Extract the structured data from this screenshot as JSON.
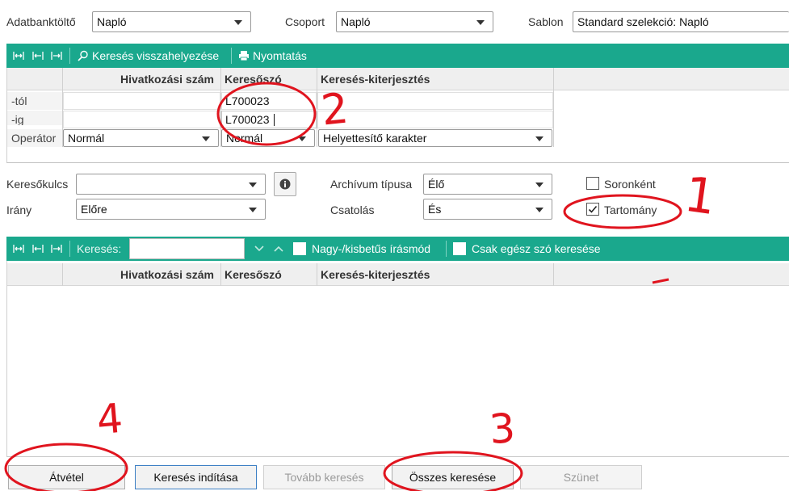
{
  "top_row": {
    "databank_label": "Adatbanktöltő",
    "databank_value": "Napló",
    "group_label": "Csoport",
    "group_value": "Napló",
    "template_label": "Sablon",
    "template_value": "Standard szelekció: Napló"
  },
  "toolbar1": {
    "reset_search": "Keresés visszahelyezése",
    "print": "Nyomtatás"
  },
  "criteria_grid": {
    "columns": [
      "Hivatkozási szám",
      "Keresőszó",
      "Keresés-kiterjesztés"
    ],
    "rows": {
      "from_label": "-tól",
      "to_label": "-ig",
      "operator_label": "Operátor"
    },
    "from_keyword": "L700023",
    "to_keyword": "L700023",
    "operator_ref": "Normál",
    "operator_keyword": "Normál",
    "operator_extension": "Helyettesítő karakter"
  },
  "options": {
    "search_key_label": "Keresőkulcs",
    "search_key_value": "",
    "direction_label": "Irány",
    "direction_value": "Előre",
    "archive_type_label": "Archívum típusa",
    "archive_type_value": "Élő",
    "link_label": "Csatolás",
    "link_value": "És",
    "per_row_label": "Soronként",
    "per_row_checked": false,
    "range_label": "Tartomány",
    "range_checked": true
  },
  "toolbar2": {
    "search_label": "Keresés:",
    "search_value": "",
    "case_label": "Nagy-/kisbetűs írásmód",
    "whole_word_label": "Csak egész szó keresése"
  },
  "results_grid": {
    "columns": [
      "Hivatkozási szám",
      "Keresőszó",
      "Keresés-kiterjesztés"
    ]
  },
  "buttons": {
    "accept": "Átvétel",
    "start_search": "Keresés indítása",
    "continue_search": "Tovább keresés",
    "search_all": "Összes keresése",
    "pause": "Szünet"
  },
  "annotations": {
    "n1": "1",
    "n2": "2",
    "n3": "3",
    "n4": "4",
    "color": "#e0141e"
  },
  "colors": {
    "toolbar": "#1aa88d",
    "primary_border": "#3c7fc4"
  }
}
